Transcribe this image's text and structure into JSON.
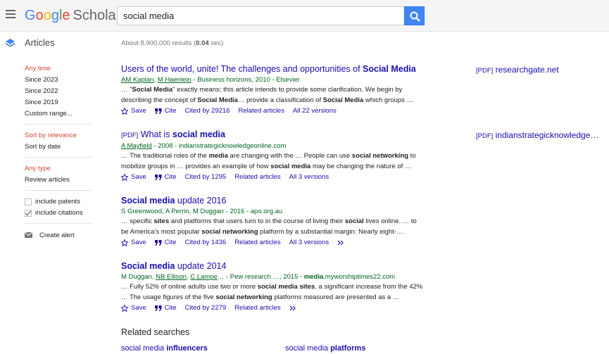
{
  "header": {
    "logo_g": "G",
    "logo_o1": "o",
    "logo_o2": "o",
    "logo_g2": "g",
    "logo_l": "l",
    "logo_e": "e",
    "logo_scholar": "Scholar",
    "search_value": "social media"
  },
  "subheader": {
    "articles_label": "Articles",
    "stats_prefix": "About 8,900,000 results (",
    "stats_time": "0.04",
    "stats_suffix": " sec)"
  },
  "sidebar": {
    "time": [
      "Any time",
      "Since 2023",
      "Since 2022",
      "Since 2019",
      "Custom range..."
    ],
    "sort": [
      "Sort by relevance",
      "Sort by date"
    ],
    "type": [
      "Any type",
      "Review articles"
    ],
    "include_patents": "include patents",
    "include_citations": "include citations",
    "create_alert": "Create alert"
  },
  "results": [
    {
      "title_a": "Users of the world, unite! The challenges and opportunities of ",
      "title_b": "Social Media",
      "author1": "AM Kaplan",
      "author_sep": ", ",
      "author2": "M Haenlein",
      "source": " - Business horizons, 2010 - Elsevier",
      "snippet": [
        "… \"",
        "Social Media",
        "\" exactly means; this article intends to provide some clarification. We begin by describing the concept of ",
        "Social Media",
        "… provide a classification of ",
        "Social Media",
        " which groups …"
      ],
      "save": "Save",
      "cite": "Cite",
      "cited_by": "Cited by 29216",
      "related": "Related articles",
      "versions": "All 22 versions",
      "side_tag": "[PDF]",
      "side_link": "researchgate.net"
    },
    {
      "tag": "[PDF]",
      "title_a": "What is ",
      "title_b": "social media",
      "author1": "A Mayfield",
      "source": " - 2008 - indianstrategicknowledgeonline.com",
      "snippet": [
        "… The traditional roles of the ",
        "media",
        " are changing with the … People can use ",
        "social networking",
        " to mobilize groups in … provides an example of how ",
        "social media",
        " may be changing the nature of …"
      ],
      "save": "Save",
      "cite": "Cite",
      "cited_by": "Cited by 1295",
      "related": "Related articles",
      "versions": "All 3 versions",
      "side_tag": "[PDF]",
      "side_link": "indianstrategicknowledge…"
    },
    {
      "title_a": "Social media",
      "title_b": " update 2016",
      "authors": "S Greenwood, A Perrin, M Duggan - 2016 - apo.org.au",
      "snippet": [
        "… specific ",
        "sites",
        " and platforms that users turn to in the course of living their ",
        "social",
        " lives online. … to be America's most popular ",
        "social networking",
        " platform by a substantial margin: Nearly eight-…"
      ],
      "save": "Save",
      "cite": "Cite",
      "cited_by": "Cited by 1436",
      "related": "Related articles",
      "versions": "All 3 versions"
    },
    {
      "title_a": "Social media",
      "title_b": " update 2014",
      "author1": "M Duggan",
      "author2": "NB Ellison",
      "author3": "C Lampe",
      "source_a": "… - Pew research …, 2015 - ",
      "source_b": "media",
      "source_c": ".myworshiptimes22.com",
      "snippet": [
        "… Fully 52% of online adults use two or more ",
        "social media sites",
        ", a significant increase from the 42% … The usage figures of the five ",
        "social networking",
        " platforms measured are presented as a …"
      ],
      "save": "Save",
      "cite": "Cite",
      "cited_by": "Cited by 2279",
      "related": "Related articles"
    }
  ],
  "related_searches": {
    "title": "Related searches",
    "items": [
      {
        "a": "social media ",
        "b": "influencers"
      },
      {
        "a": "social media ",
        "b": "platforms"
      }
    ]
  },
  "colors": {
    "accent": "#4285f4",
    "link": "#1a0dab",
    "green": "#006621",
    "active": "#d14836"
  }
}
